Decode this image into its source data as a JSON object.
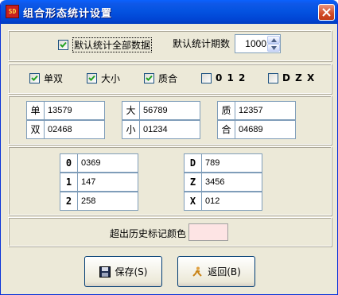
{
  "window": {
    "title": "组合形态统计设置",
    "icon": "app-icon",
    "close": "close-icon"
  },
  "options": {
    "default_all": {
      "label": "默认统计全部数据",
      "checked": true
    },
    "default_periods_label": "默认统计期数",
    "default_periods_value": "1000"
  },
  "types": [
    {
      "label": "单双",
      "checked": true
    },
    {
      "label": "大小",
      "checked": true
    },
    {
      "label": "质合",
      "checked": true
    },
    {
      "label": "0 1 2",
      "checked": false
    },
    {
      "label": "D Z X",
      "checked": false
    }
  ],
  "groups": [
    {
      "key": "单",
      "value": "13579"
    },
    {
      "key": "双",
      "value": "02468"
    },
    {
      "key": "大",
      "value": "56789"
    },
    {
      "key": "小",
      "value": "01234"
    },
    {
      "key": "质",
      "value": "12357"
    },
    {
      "key": "合",
      "value": "04689"
    }
  ],
  "road": [
    {
      "key": "0",
      "value": "0369"
    },
    {
      "key": "1",
      "value": "147"
    },
    {
      "key": "2",
      "value": "258"
    }
  ],
  "dzx": [
    {
      "key": "D",
      "value": "789"
    },
    {
      "key": "Z",
      "value": "3456"
    },
    {
      "key": "X",
      "value": "012"
    }
  ],
  "color_row": {
    "label": "超出历史标记颜色",
    "color": "#fde4e4"
  },
  "buttons": {
    "save": "保存(S)",
    "back": "返回(B)"
  },
  "colors": {
    "titlebar": "#0453e1",
    "face": "#ece9d8",
    "check": "#21a121"
  }
}
